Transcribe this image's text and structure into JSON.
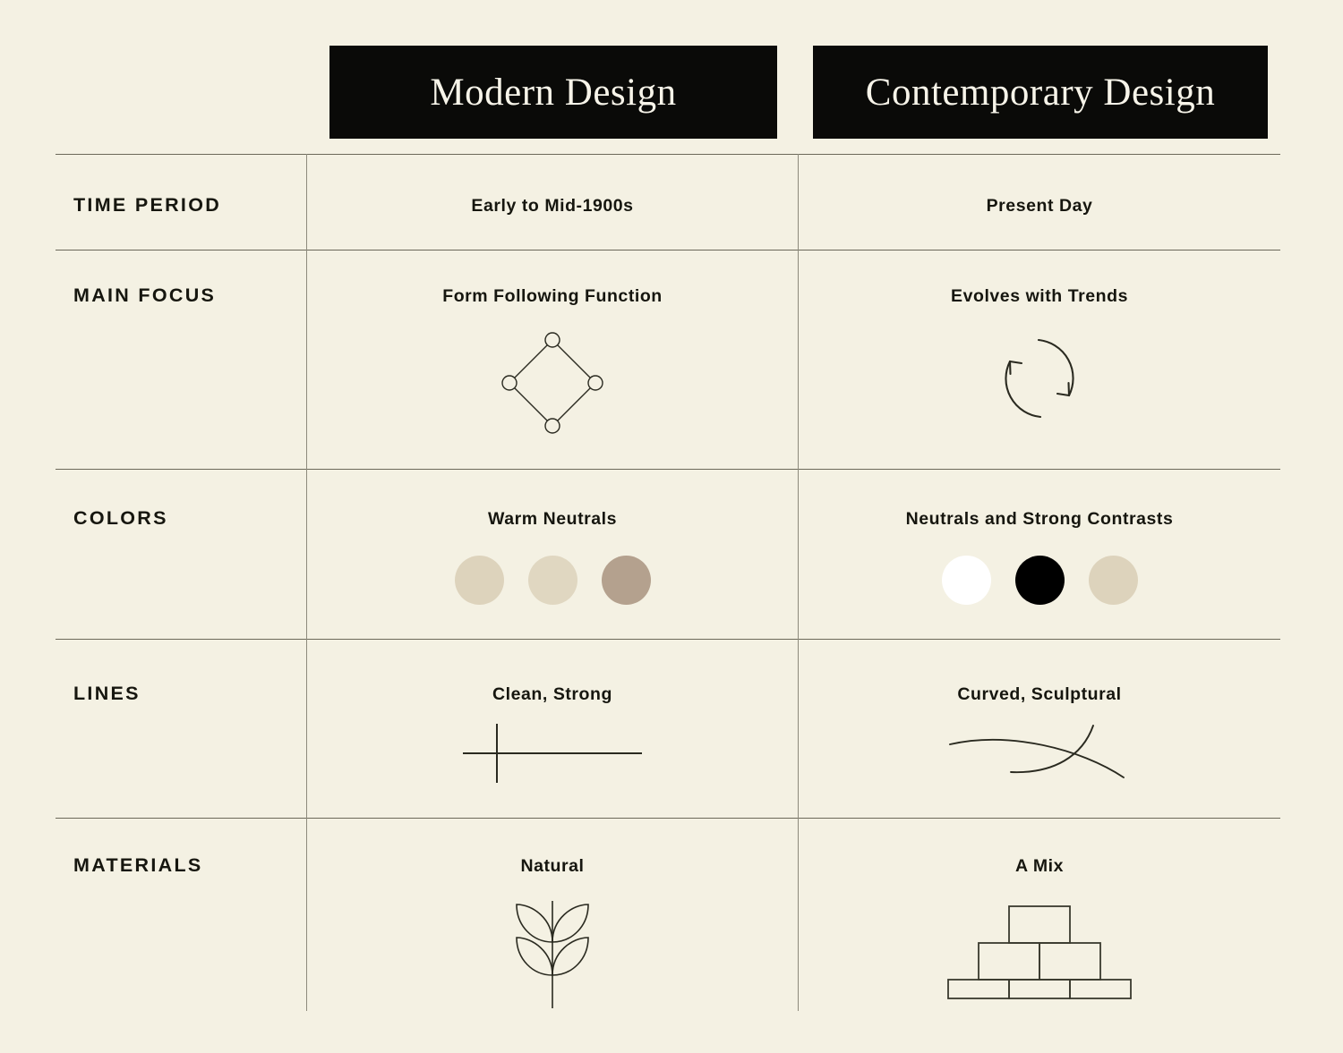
{
  "background_color": "#F4F1E3",
  "header": {
    "columns": [
      {
        "label": "Modern Design",
        "bar_color": "#0A0A08",
        "text_color": "#F7F4E9"
      },
      {
        "label": "Contemporary Design",
        "bar_color": "#0A0A08",
        "text_color": "#F7F4E9"
      }
    ]
  },
  "rows": [
    {
      "label": "TIME PERIOD",
      "modern": {
        "text": "Early to Mid-1900s",
        "icon": null
      },
      "contemporary": {
        "text": "Present Day",
        "icon": null
      }
    },
    {
      "label": "MAIN FOCUS",
      "modern": {
        "text": "Form Following Function",
        "icon": "diamond-nodes-icon"
      },
      "contemporary": {
        "text": "Evolves with Trends",
        "icon": "circular-arrows-icon"
      }
    },
    {
      "label": "COLORS",
      "modern": {
        "text": "Warm Neutrals",
        "icon": "color-swatches-icon",
        "swatches": [
          "#DDD3BC",
          "#E0D7C1",
          "#B4A18E"
        ]
      },
      "contemporary": {
        "text": "Neutrals and Strong Contrasts",
        "icon": "color-swatches-icon",
        "swatches": [
          "#FFFFFF",
          "#000000",
          "#DDD3BC"
        ]
      }
    },
    {
      "label": "LINES",
      "modern": {
        "text": "Clean, Strong",
        "icon": "cross-lines-icon"
      },
      "contemporary": {
        "text": "Curved, Sculptural",
        "icon": "curved-lines-icon"
      }
    },
    {
      "label": "MATERIALS",
      "modern": {
        "text": "Natural",
        "icon": "plant-leaf-icon"
      },
      "contemporary": {
        "text": "A Mix",
        "icon": "brick-stack-icon"
      }
    }
  ]
}
